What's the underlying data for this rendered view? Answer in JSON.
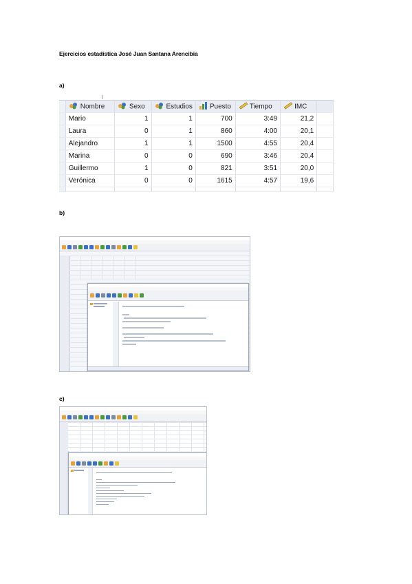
{
  "document": {
    "title": "Ejercicios estadística José Juan Santana Arencibia"
  },
  "sections": {
    "a": "a)",
    "b": "b)",
    "c": "c)"
  },
  "table_a": {
    "columns": [
      {
        "label": "Nombre",
        "icon": "nominal-variable-icon"
      },
      {
        "label": "Sexo",
        "icon": "nominal-variable-icon"
      },
      {
        "label": "Estudios",
        "icon": "nominal-variable-icon"
      },
      {
        "label": "Puesto",
        "icon": "scale-variable-icon"
      },
      {
        "label": "Tiempo",
        "icon": "ruler-variable-icon"
      },
      {
        "label": "IMC",
        "icon": "ruler-variable-icon"
      }
    ],
    "rows": [
      [
        "Mario",
        "1",
        "1",
        "700",
        "3:49",
        "21,2"
      ],
      [
        "Laura",
        "0",
        "1",
        "860",
        "4:00",
        "20,1"
      ],
      [
        "Alejandro",
        "1",
        "1",
        "1500",
        "4:55",
        "20,4"
      ],
      [
        "Marina",
        "0",
        "0",
        "690",
        "3:46",
        "20,4"
      ],
      [
        "Guillermo",
        "1",
        "0",
        "821",
        "3:51",
        "20,0"
      ],
      [
        "Verónica",
        "0",
        "0",
        "1615",
        "4:57",
        "19,6"
      ]
    ]
  },
  "colors": {
    "header_bg": "#e9edf3",
    "grid_line": "#d8dde6",
    "app_toolbar": "#f0f2f5",
    "accent_orange": "#e8a23a",
    "accent_blue": "#3a6fc4",
    "accent_green": "#4a9a3c"
  }
}
